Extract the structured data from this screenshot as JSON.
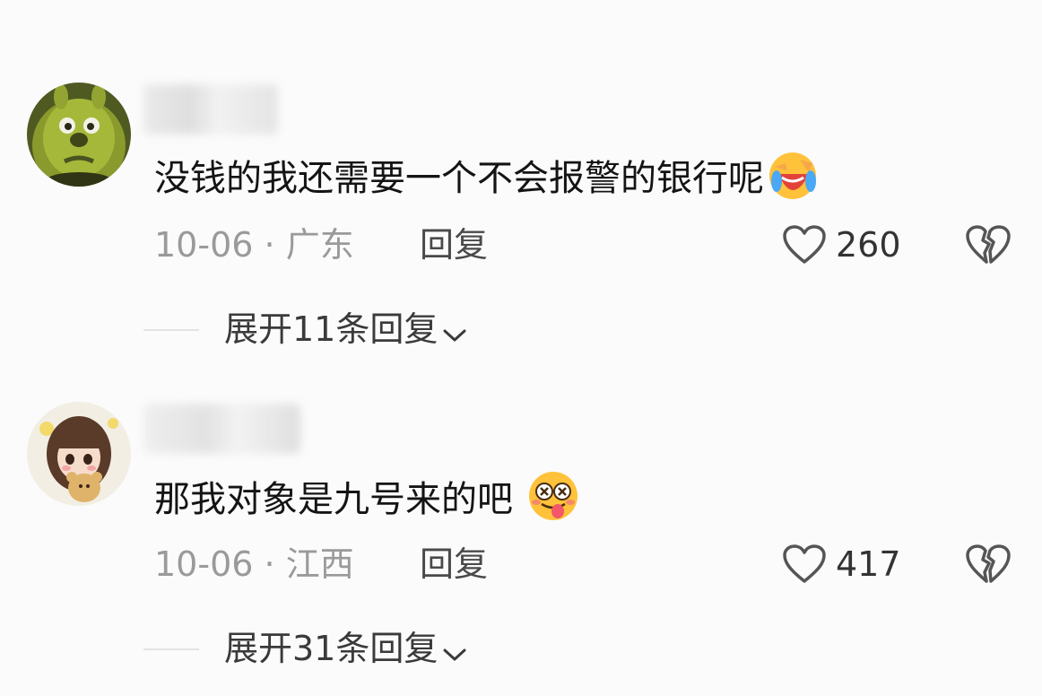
{
  "comments": [
    {
      "avatar_icon": "green-monster-avatar",
      "text": "没钱的我还需要一个不会报警的银行呢",
      "emoji_icon": "laughing-crying-emoji",
      "date": "10-06",
      "separator": "·",
      "location": "广东",
      "reply_label": "回复",
      "likes": "260",
      "expand_label": "展开11条回复"
    },
    {
      "avatar_icon": "anime-girl-avatar",
      "text": "那我对象是九号来的吧",
      "emoji_icon": "silly-tongue-emoji",
      "date": "10-06",
      "separator": "·",
      "location": "江西",
      "reply_label": "回复",
      "likes": "417",
      "expand_label": "展开31条回复"
    }
  ],
  "colors": {
    "background": "#fbfbfb",
    "text": "#141414",
    "meta": "#9a9a9a",
    "icon": "#555555"
  }
}
